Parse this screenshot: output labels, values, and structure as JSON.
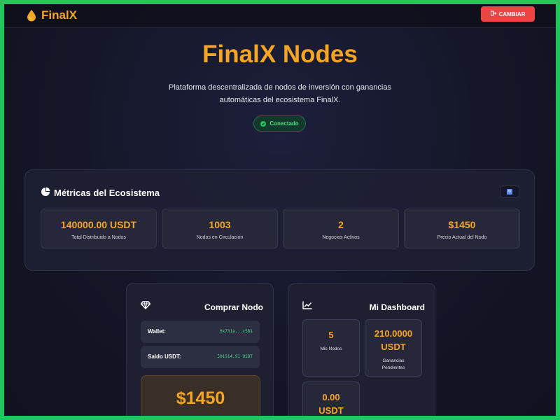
{
  "navbar": {
    "brand": "FinalX",
    "change_button": "CAMBIAR"
  },
  "hero": {
    "title": "FinalX Nodes",
    "subtitle": "Plataforma descentralizada de nodos de inversión con ganancias automáticas del ecosistema FinalX.",
    "status": "Conectado"
  },
  "metrics": {
    "title": "Métricas del Ecosistema",
    "cards": [
      {
        "value": "140000.00 USDT",
        "label": "Total Distribuido a Nodos"
      },
      {
        "value": "1003",
        "label": "Nodos en Circulación"
      },
      {
        "value": "2",
        "label": "Negocios Activos"
      },
      {
        "value": "$1450",
        "label": "Precio Actual del Nodo"
      }
    ]
  },
  "buy": {
    "title": "Comprar Nodo",
    "wallet_label": "Wallet:",
    "wallet_value": "0x731a...c5B1",
    "balance_label": "Saldo USDT:",
    "balance_value": "501514.91 USDT",
    "price": "$1450"
  },
  "dashboard": {
    "title": "Mi Dashboard",
    "cards": [
      {
        "value": "5",
        "label": "Mis Nodos"
      },
      {
        "value": "210.0000 USDT",
        "label": "Ganancias Pendientes"
      },
      {
        "value": "0.00 USDT",
        "label": ""
      }
    ]
  },
  "colors": {
    "accent": "#f5a524",
    "danger": "#ef4444",
    "success": "#22c55e",
    "background": "#141627"
  }
}
